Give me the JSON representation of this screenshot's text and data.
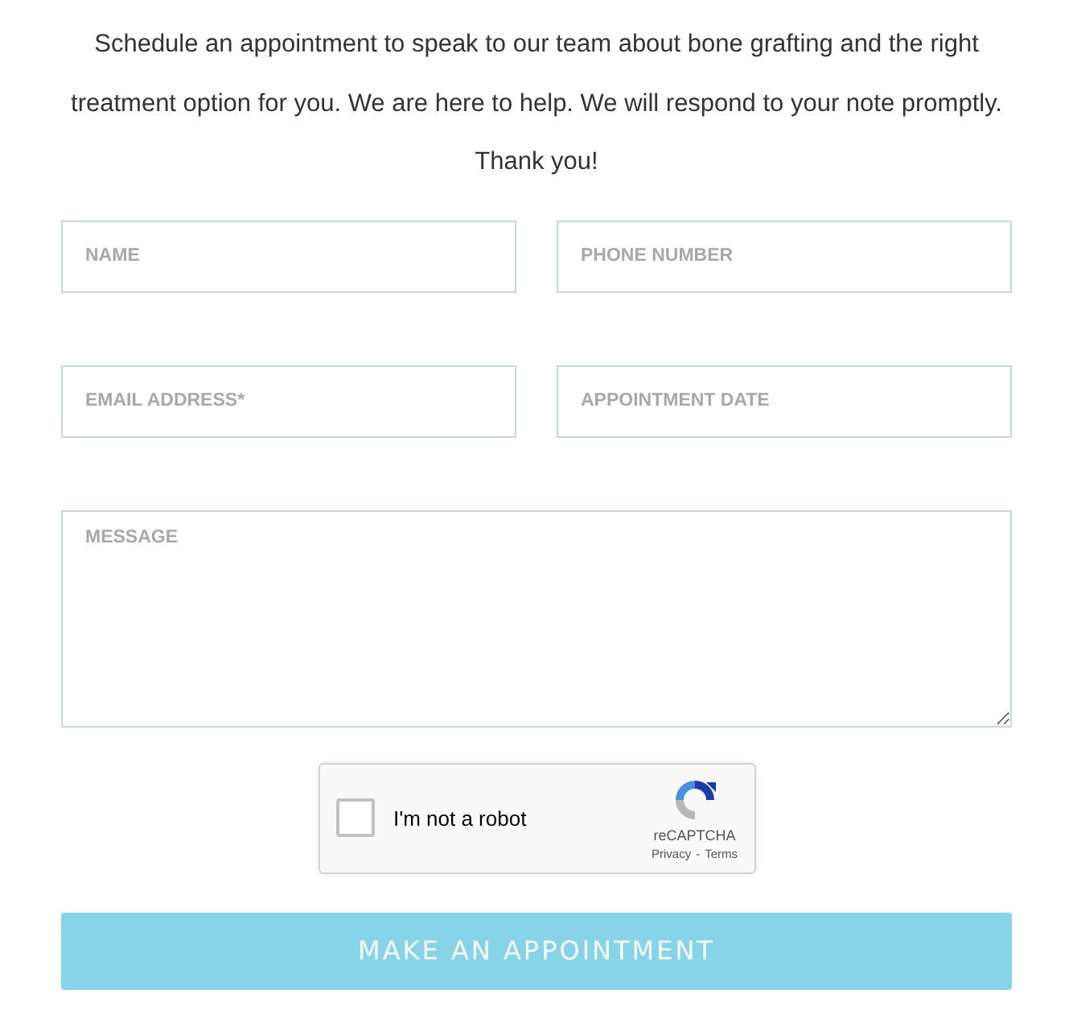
{
  "intro": "Schedule an appointment to speak to our team about bone grafting and the right treatment option for you. We are here to help. We will respond to your note promptly. Thank you!",
  "fields": [
    {
      "placeholder": "NAME",
      "kind": "line"
    },
    {
      "placeholder": "PHONE NUMBER",
      "kind": "line"
    },
    {
      "placeholder": "EMAIL ADDRESS*",
      "kind": "line"
    },
    {
      "placeholder": "APPOINTMENT DATE",
      "kind": "line"
    },
    {
      "placeholder": "MESSAGE",
      "kind": "area"
    }
  ],
  "captcha": {
    "label": "I'm not a robot",
    "checked": false,
    "brand": "reCAPTCHA",
    "links": [
      "Privacy",
      "Terms"
    ],
    "separator": "-"
  },
  "submit": "MAKE AN APPOINTMENT"
}
